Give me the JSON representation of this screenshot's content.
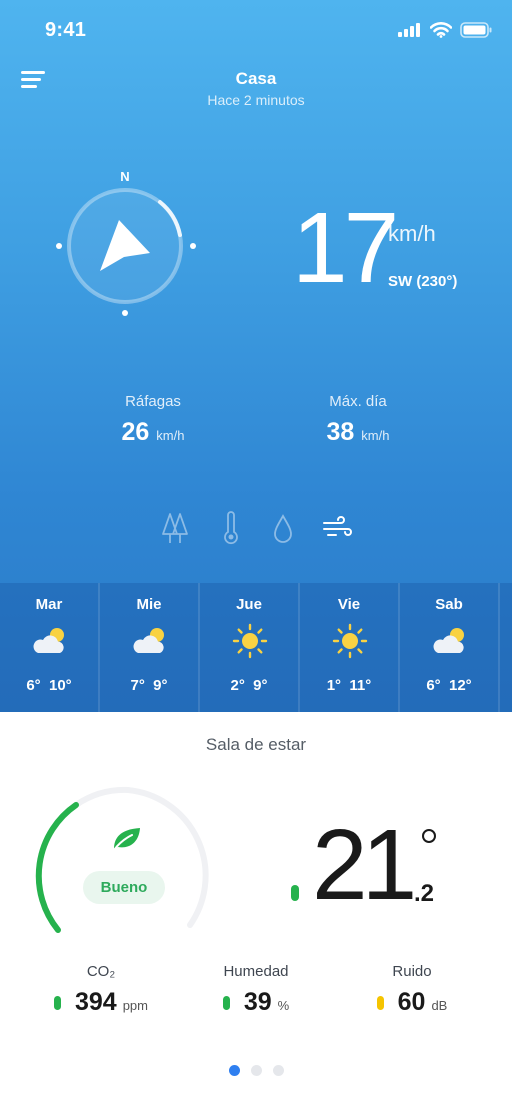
{
  "status": {
    "time": "9:41"
  },
  "header": {
    "title": "Casa",
    "subtitle": "Hace 2 minutos"
  },
  "compass": {
    "north": "N",
    "heading_deg": 230
  },
  "wind": {
    "speed": "17",
    "unit": "km/h",
    "direction": "SW (230°)"
  },
  "stats": [
    {
      "label": "Ráfagas",
      "value": "26",
      "unit": "km/h"
    },
    {
      "label": "Máx. día",
      "value": "38",
      "unit": "km/h"
    }
  ],
  "tabs": [
    {
      "icon": "tree-icon",
      "active": false
    },
    {
      "icon": "thermometer-icon",
      "active": false
    },
    {
      "icon": "drop-icon",
      "active": false
    },
    {
      "icon": "wind-icon",
      "active": true
    }
  ],
  "forecast": [
    {
      "day": "Mar",
      "icon": "partly-cloudy-icon",
      "min": "6°",
      "max": "10°"
    },
    {
      "day": "Mie",
      "icon": "partly-cloudy-icon",
      "min": "7°",
      "max": "9°"
    },
    {
      "day": "Jue",
      "icon": "sun-icon",
      "min": "2°",
      "max": "9°"
    },
    {
      "day": "Vie",
      "icon": "sun-icon",
      "min": "1°",
      "max": "11°"
    },
    {
      "day": "Sab",
      "icon": "partly-cloudy-icon",
      "min": "6°",
      "max": "12°"
    }
  ],
  "room": {
    "title": "Sala de estar",
    "quality_label": "Bueno",
    "quality_level": 0.3,
    "temperature_int": "21",
    "temperature_dec": ".2",
    "metrics": [
      {
        "label": "CO₂",
        "value": "394",
        "unit": "ppm",
        "color": "#26b24d"
      },
      {
        "label": "Humedad",
        "value": "39",
        "unit": "%",
        "color": "#26b24d"
      },
      {
        "label": "Ruido",
        "value": "60",
        "unit": "dB",
        "color": "#f5c400"
      }
    ]
  },
  "pagination": {
    "count": 3,
    "active": 0
  },
  "colors": {
    "accent": "#2f7ff0",
    "good": "#26b24d",
    "warn": "#f5c400"
  }
}
